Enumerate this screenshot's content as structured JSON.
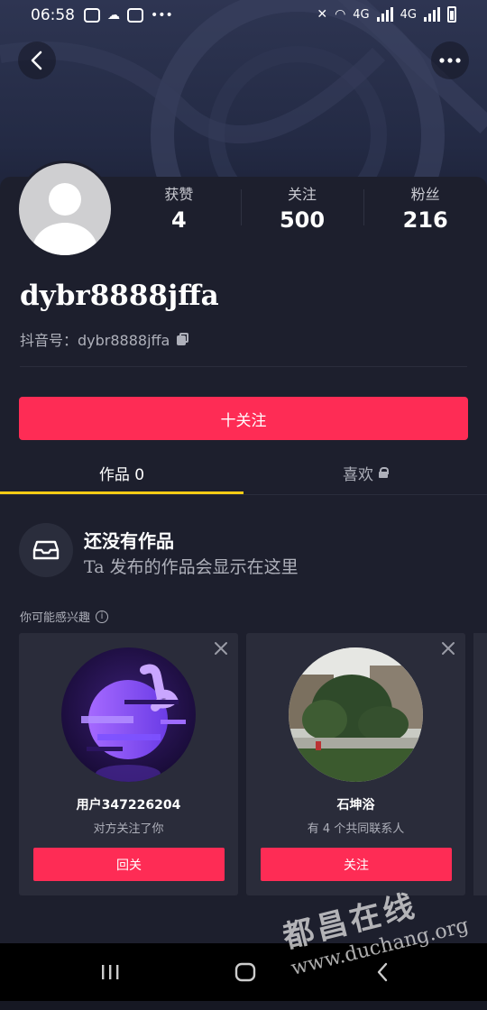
{
  "status_bar": {
    "time": "06:58",
    "network": "4G",
    "network2": "4G"
  },
  "profile": {
    "username": "dybr8888jffa",
    "account_label": "抖音号：dybr8888jffa",
    "stats": [
      {
        "label": "获赞",
        "value": "4"
      },
      {
        "label": "关注",
        "value": "500"
      },
      {
        "label": "粉丝",
        "value": "216"
      }
    ],
    "follow_button": "十关注"
  },
  "tabs": [
    {
      "label": "作品 0",
      "active": true
    },
    {
      "label": "喜欢",
      "active": false,
      "locked": true
    }
  ],
  "empty_state": {
    "title": "还没有作品",
    "subtitle": "Ta 发布的作品会显示在这里"
  },
  "suggestions": {
    "label": "你可能感兴趣",
    "info_icon": "i",
    "cards": [
      {
        "name": "用户347226204",
        "desc": "对方关注了你",
        "button": "回关"
      },
      {
        "name": "石坤浴",
        "desc": "有 4 个共同联系人",
        "button": "关注"
      }
    ]
  },
  "watermark": {
    "text_cn": "都昌在线",
    "url": "www.duchang.org"
  },
  "colors": {
    "accent": "#fe2c55",
    "tab_indicator": "#facc15",
    "background": "#161823",
    "panel": "#1d1f2d"
  }
}
